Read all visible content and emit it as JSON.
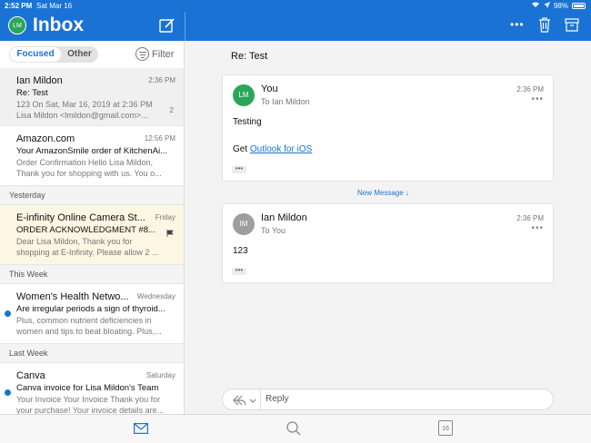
{
  "status": {
    "time": "2:52 PM",
    "date": "Sat Mar 16",
    "battery": "98%"
  },
  "header": {
    "avatar_initials": "LM",
    "title": "Inbox"
  },
  "tabs": {
    "focused": "Focused",
    "other": "Other",
    "filter": "Filter"
  },
  "messages": [
    {
      "sender": "Ian Mildon",
      "time": "2:36 PM",
      "subject": "Re: Test",
      "preview1": "123 On Sat, Mar 16, 2019 at 2:36 PM",
      "preview2": "Lisa Mildon <lmildon@gmail.com>...",
      "count": "2"
    },
    {
      "sender": "Amazon.com",
      "time": "12:56 PM",
      "subject": "Your AmazonSmile order of KitchenAi...",
      "preview1": "Order Confirmation Hello Lisa Mildon,",
      "preview2": "Thank you for shopping with us. You o..."
    },
    {
      "sender": "E-infinity Online Camera St...",
      "time": "Friday",
      "subject": "ORDER ACKNOWLEDGMENT #8...",
      "preview1": "Dear Lisa Mildon, Thank you for",
      "preview2": "shopping at E-Infinity. Please allow 2 ..."
    },
    {
      "sender": "Women's Health Netwo...",
      "time": "Wednesday",
      "subject": "Are irregular periods a sign of thyroid...",
      "preview1": "Plus, common nutrient deficiencies in",
      "preview2": "women and tips to beat bloating. Plus,..."
    },
    {
      "sender": "Canva",
      "time": "Saturday",
      "subject": "Canva invoice for Lisa Mildon's Team",
      "preview1": "Your Invoice Your Invoice Thank you for",
      "preview2": "your purchase! Your invoice details are..."
    }
  ],
  "sections": {
    "yesterday": "Yesterday",
    "this_week": "This Week",
    "last_week": "Last Week"
  },
  "thread": {
    "subject": "Re: Test",
    "new_message": "New Message ↓",
    "cards": [
      {
        "avatar": "LM",
        "from": "You",
        "to": "To Ian Mildon",
        "time": "2:36 PM",
        "line1": "Testing",
        "line2_prefix": "Get ",
        "line2_link": "Outlook for iOS"
      },
      {
        "avatar": "IM",
        "from": "Ian Mildon",
        "to": "To You",
        "time": "2:36 PM",
        "line1": "123"
      }
    ]
  },
  "reply": {
    "placeholder": "Reply"
  },
  "tabbar": {
    "calendar_day": "16"
  },
  "colors": {
    "accent": "#1a73d4",
    "avatar_green": "#2aa65a",
    "avatar_gray": "#9e9e9e",
    "selected_row": "#f0f0f0",
    "flagged_row": "#fdf6e3"
  },
  "icons": [
    "compose-icon",
    "more-icon",
    "trash-icon",
    "archive-icon",
    "filter-icon",
    "flag-icon",
    "reply-icon",
    "mail-icon",
    "search-icon",
    "calendar-icon"
  ]
}
